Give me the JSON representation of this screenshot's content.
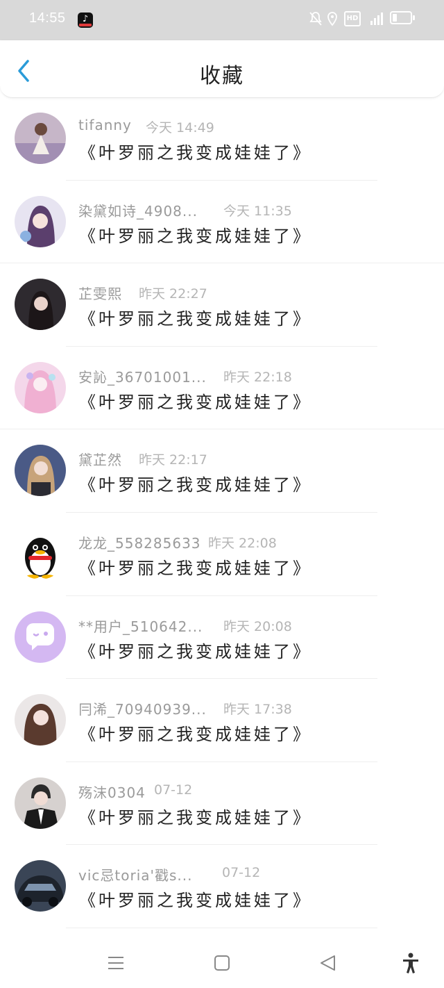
{
  "status_bar": {
    "time": "14:55",
    "app_badge": "tiktok-icon",
    "hd_label": "HD",
    "signal_label": "4G",
    "icons": [
      "mute-bell-icon",
      "location-icon",
      "hd-icon",
      "signal-icon",
      "battery-icon"
    ]
  },
  "header": {
    "title": "收藏",
    "back_icon": "chevron-left-icon",
    "accent": "#2a9bd8"
  },
  "items": [
    {
      "name": "tifanny",
      "time": "今天 14:49",
      "content": "《叶罗丽之我变成娃娃了》",
      "avatar": "photo-avatar"
    },
    {
      "name": "染黛如诗_4908...",
      "time": "今天 11:35",
      "content": "《叶罗丽之我变成娃娃了》",
      "avatar": "anime-avatar"
    },
    {
      "name": "芷雯熙",
      "time": "昨天 22:27",
      "content": "《叶罗丽之我变成娃娃了》",
      "avatar": "photo-avatar"
    },
    {
      "name": "安訫_36701001...",
      "time": "昨天 22:18",
      "content": "《叶罗丽之我变成娃娃了》",
      "avatar": "anime-avatar"
    },
    {
      "name": "黛芷然",
      "time": "昨天 22:17",
      "content": "《叶罗丽之我变成娃娃了》",
      "avatar": "photo-avatar"
    },
    {
      "name": "龙龙_558285633",
      "time": "昨天 22:08",
      "content": "《叶罗丽之我变成娃娃了》",
      "avatar": "qq-penguin-avatar"
    },
    {
      "name": "**用户_510642...",
      "time": "昨天 20:08",
      "content": "《叶罗丽之我变成娃娃了》",
      "avatar": "chat-bubble-avatar"
    },
    {
      "name": "冃浠_70940939...",
      "time": "昨天 17:38",
      "content": "《叶罗丽之我变成娃娃了》",
      "avatar": "photo-avatar"
    },
    {
      "name": "殇沫0304",
      "time": "07-12",
      "content": "《叶罗丽之我变成娃娃了》",
      "avatar": "photo-avatar"
    },
    {
      "name": "vic忌toria'戳s...",
      "time": "07-12",
      "content": "《叶罗丽之我变成娃娃了》",
      "avatar": "car-avatar"
    }
  ],
  "navbar": {
    "icons": [
      "menu-icon",
      "home-square-icon",
      "back-triangle-icon",
      "accessibility-icon"
    ]
  }
}
